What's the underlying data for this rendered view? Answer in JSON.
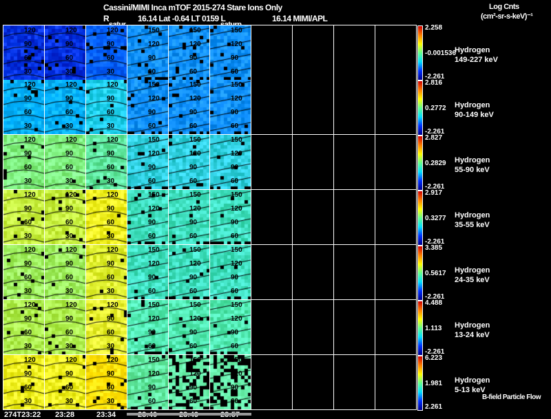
{
  "header": {
    "title": "Cassini/MIMI Inca mTOF  2015-274   Stare   Ions Only",
    "subtitle_r": "R",
    "subtitle_pos": "16.14 Lat -0.64 LT 0159 L",
    "subtitle_l": "16.14  MIMI/APL",
    "saturation_1": "satur",
    "saturation_2": "saturn",
    "units_title": "Log Cnts",
    "units": "(cm²-sr-s-keV)⁻¹",
    "footer_note": "B-field Particle Flow"
  },
  "chart_data": {
    "type": "heatmap",
    "title": "Cassini/MIMI Inca mTOF 2015-274 Stare Ions Only",
    "time_labels": [
      "274T23:22",
      "23:28",
      "23:34",
      "23:40",
      "23:49",
      "23:57"
    ],
    "contour_labels_early": [
      "120",
      "90",
      "60",
      "30"
    ],
    "contour_labels_late": [
      "150",
      "120",
      "90",
      "60"
    ],
    "rows": [
      {
        "species": "Hydrogen",
        "energy": "149-227 keV",
        "max": "2.258",
        "mid": "-0.001536",
        "min": "-2.261",
        "colors": [
          "#0030e0",
          "#0060ff",
          "#1090ff"
        ]
      },
      {
        "species": "Hydrogen",
        "energy": "90-149 keV",
        "max": "2.816",
        "mid": "0.2772",
        "min": "-2.261",
        "colors": [
          "#00b0ff",
          "#20d0f0",
          "#1090ff"
        ]
      },
      {
        "species": "Hydrogen",
        "energy": "55-90 keV",
        "max": "2.827",
        "mid": "0.2829",
        "min": "-2.261",
        "colors": [
          "#80f080",
          "#60e8a0",
          "#30d0e0"
        ]
      },
      {
        "species": "Hydrogen",
        "energy": "35-55 keV",
        "max": "2.917",
        "mid": "0.3277",
        "min": "-2.261",
        "colors": [
          "#c8f040",
          "#f0f020",
          "#40e0c0"
        ]
      },
      {
        "species": "Hydrogen",
        "energy": "24-35 keV",
        "max": "3.385",
        "mid": "0.5617",
        "min": "-2.261",
        "colors": [
          "#a0f060",
          "#e0f030",
          "#40e0c0"
        ]
      },
      {
        "species": "Hydrogen",
        "energy": "13-24 keV",
        "max": "4.488",
        "mid": "1.113",
        "min": "-2.261",
        "colors": [
          "#b0f050",
          "#e8f030",
          "#50e8b0"
        ]
      },
      {
        "species": "Hydrogen",
        "energy": "5-13 keV",
        "max": "6.223",
        "mid": "1.981",
        "min": "2.261",
        "colors": [
          "#f0f020",
          "#ffe000",
          "#60e8a0"
        ]
      }
    ]
  }
}
